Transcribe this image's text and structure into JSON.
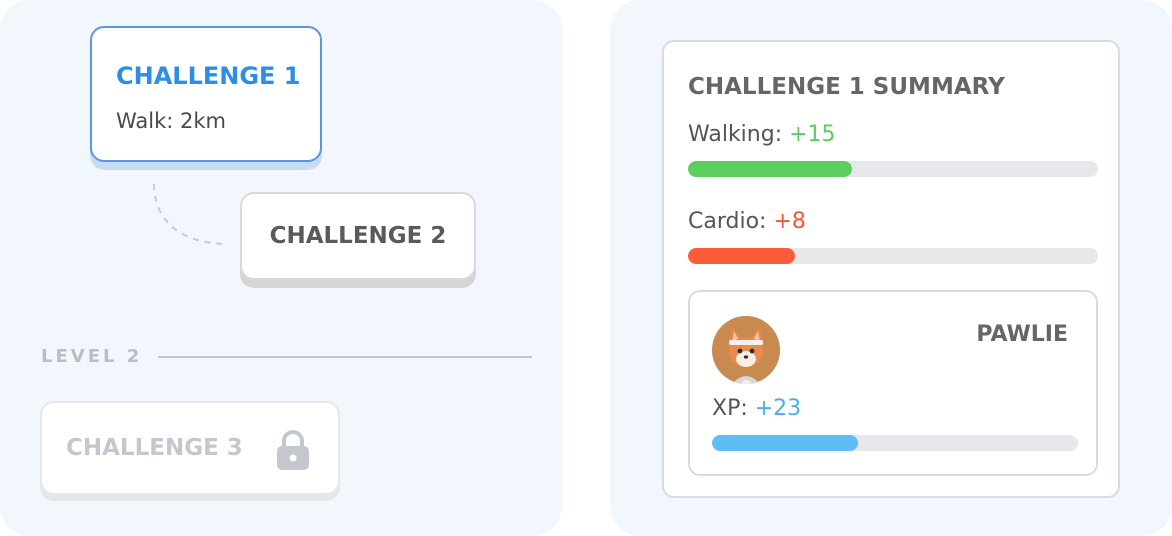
{
  "left_panel": {
    "challenge_1": {
      "title": "CHALLENGE 1",
      "description": "Walk: 2km"
    },
    "challenge_2": {
      "title": "CHALLENGE 2"
    },
    "level_2": {
      "label": "LEVEL 2"
    },
    "challenge_3": {
      "title": "CHALLENGE 3",
      "locked_icon": "lock-icon"
    }
  },
  "summary": {
    "title": "CHALLENGE 1 SUMMARY",
    "walking": {
      "label": "Walking:",
      "value": "+15",
      "progress": 0.4,
      "color": "#5bcf5e"
    },
    "cardio": {
      "label": "Cardio:",
      "value": "+8",
      "progress": 0.26,
      "color": "#fe5b39"
    },
    "pet": {
      "name": "PAWLIE",
      "avatar_icon": "fox-avatar-icon",
      "xp_label": "XP:",
      "xp_value": "+23",
      "xp_progress": 0.4,
      "xp_color": "#5dbdf5"
    }
  }
}
